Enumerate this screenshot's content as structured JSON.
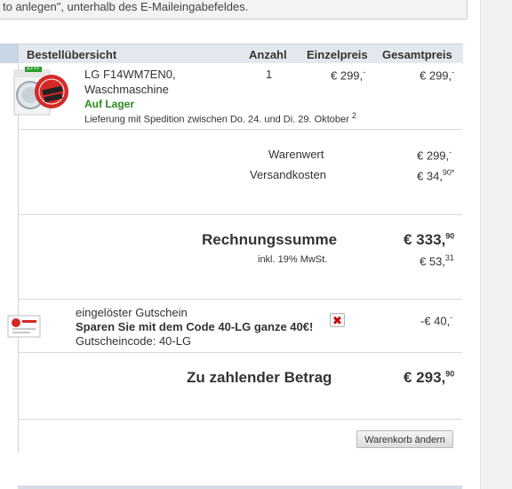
{
  "notice": {
    "text": "to anlegen\", unterhalb des E-Maileingabefeldes."
  },
  "table": {
    "headers": {
      "overview": "Bestellübersicht",
      "qty": "Anzahl",
      "unit_price": "Einzelpreis",
      "total_price": "Gesamtpreis"
    },
    "item": {
      "name_line1": "LG F14WM7EN0,",
      "name_line2": "Waschmaschine",
      "availability": "Auf Lager",
      "delivery": "Lieferung mit Spedition zwischen Do. 24. und Di. 29. Oktober",
      "delivery_footnote": "2",
      "qty": "1",
      "unit_price_main": "€ 299,",
      "unit_price_sup": "-",
      "total_price_main": "€ 299,",
      "total_price_sup": "-",
      "image_badge": "ZACK ZACK",
      "energy_label": "A+++"
    }
  },
  "summary": {
    "goods_value_label": "Warenwert",
    "goods_value_main": "€ 299,",
    "goods_value_sup": "-",
    "shipping_label": "Versandkosten",
    "shipping_main": "€ 34,",
    "shipping_sup": "90*",
    "invoice_total_label": "Rechnungssumme",
    "invoice_total_main": "€ 333,",
    "invoice_total_sup": "90",
    "vat_label": "inkl. 19% MwSt.",
    "vat_main": "€ 53,",
    "vat_sup": "31"
  },
  "voucher": {
    "title": "eingelöster Gutschein",
    "promo": "Sparen Sie mit dem Code 40-LG ganze 40€!",
    "code_line": "Gutscheincode: 40-LG",
    "amount_main": "-€ 40,",
    "amount_sup": "-",
    "remove_symbol": "✖"
  },
  "payable": {
    "label": "Zu zahlender Betrag",
    "main": "€ 293,",
    "sup": "90"
  },
  "buttons": {
    "edit_cart": "Warenkorb ändern"
  },
  "colors": {
    "header_bg": "#e3e8ef",
    "available_green": "#2b8a1e",
    "remove_red": "#c40000",
    "badge_red": "#d62828"
  }
}
